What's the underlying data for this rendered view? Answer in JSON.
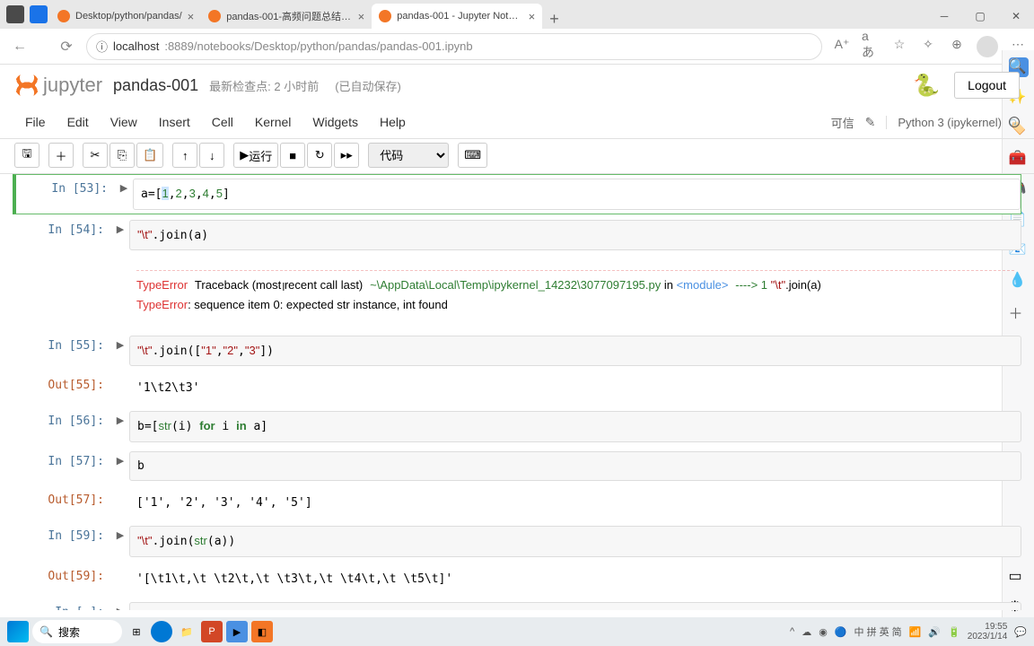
{
  "browser": {
    "tabs": [
      {
        "title": "Desktop/python/pandas/"
      },
      {
        "title": "pandas-001-高频问题总结 - Jupy"
      },
      {
        "title": "pandas-001 - Jupyter Notebook"
      }
    ],
    "url_host": "localhost",
    "url_path": ":8889/notebooks/Desktop/python/pandas/pandas-001.ipynb"
  },
  "jupyter": {
    "brand": "jupyter",
    "title": "pandas-001",
    "checkpoint": "最新检查点: 2 小时前",
    "autosave": "(已自动保存)",
    "logout": "Logout",
    "trusted": "可信",
    "kernel": "Python 3 (ipykernel)",
    "menu": [
      "File",
      "Edit",
      "View",
      "Insert",
      "Cell",
      "Kernel",
      "Widgets",
      "Help"
    ],
    "run_label": "运行",
    "celltype": "代码"
  },
  "cells": {
    "c53": {
      "prompt": "In [53]:"
    },
    "c54": {
      "prompt": "In [54]:"
    },
    "c55": {
      "prompt": "In [55]:"
    },
    "c55o": {
      "prompt": "Out[55]:",
      "text": "'1\\t2\\t3'"
    },
    "c56": {
      "prompt": "In [56]:"
    },
    "c57": {
      "prompt": "In [57]:"
    },
    "c57o": {
      "prompt": "Out[57]:",
      "text": "['1', '2', '3', '4', '5']"
    },
    "c59": {
      "prompt": "In [59]:"
    },
    "c59o": {
      "prompt": "Out[59]:",
      "text": "'[\\t1\\t,\\t \\t2\\t,\\t \\t3\\t,\\t \\t4\\t,\\t \\t5\\t]'"
    },
    "c60": {
      "prompt": "In [ ]:"
    }
  },
  "error": {
    "name": "TypeError",
    "trace": "Traceback (most recent call last)",
    "file": "~\\AppData\\Local\\Temp\\ipykernel_14232\\3077097195.py",
    "in_mod": " in ",
    "module": "<module>",
    "arrow": "----> 1 ",
    "line": "\"\\t\"",
    "line2": ".join(a)",
    "final_err": "TypeError",
    "final_msg": ": sequence item 0: expected str instance, int found"
  },
  "taskbar": {
    "search": "搜索",
    "time": "19:55",
    "date": "2023/1/14",
    "ime": "中 拼 英 简"
  }
}
